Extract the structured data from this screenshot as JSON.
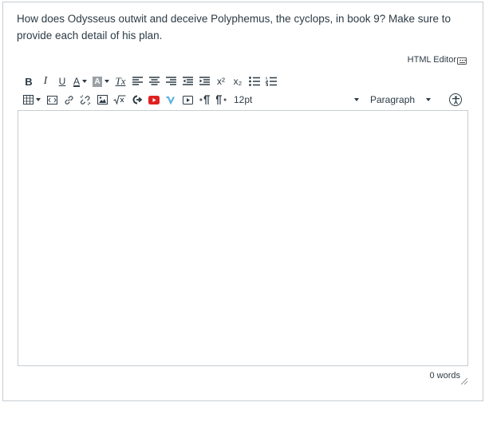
{
  "question": {
    "text": "How does Odysseus outwit and deceive Polyphemus, the cyclops, in book 9? Make sure to provide each detail of his plan."
  },
  "editor": {
    "html_editor_label": "HTML Editor",
    "toolbar_row1": {
      "bold_label": "B",
      "italic_label": "I",
      "underline_label": "U",
      "font_color_label": "A",
      "bg_color_label": "A",
      "clear_format_label": "Tx",
      "superscript_label": "x²",
      "subscript_label": "x₂"
    },
    "toolbar_row2": {
      "font_size": "12pt",
      "block_format": "Paragraph"
    },
    "content": "",
    "word_count": "0 words"
  },
  "colors": {
    "text": "#2d3b45",
    "border": "#c7cdd1",
    "youtube_red": "#e02020",
    "vimeo_blue": "#5bb3e0"
  }
}
